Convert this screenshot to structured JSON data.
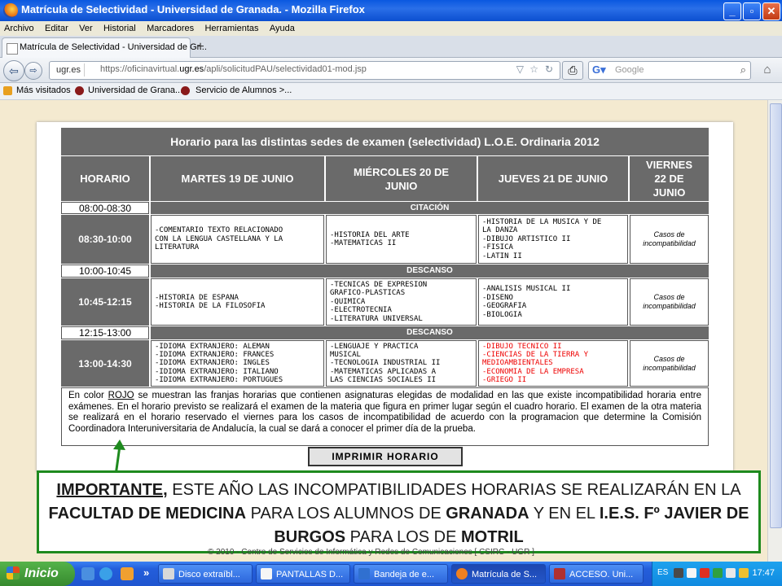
{
  "window": {
    "title": "Matrícula de Selectividad - Universidad de Granada. - Mozilla Firefox"
  },
  "menu": [
    "Archivo",
    "Editar",
    "Ver",
    "Historial",
    "Marcadores",
    "Herramientas",
    "Ayuda"
  ],
  "tab": {
    "label": "Matrícula de Selectividad - Universidad de Gr...",
    "new_tab": "+"
  },
  "nav": {
    "site": "ugr.es",
    "url_pre": "https://oficinavirtual.",
    "url_host": "ugr.es",
    "url_post": "/apli/solicitudPAU/selectividad01-mod.jsp",
    "search_engine": "Google",
    "search_placeholder": "Google"
  },
  "bookmarks": [
    "Más visitados",
    "Universidad de Grana...",
    "Servicio de Alumnos >..."
  ],
  "schedule": {
    "title": "Horario para las distintas sedes de examen (selectividad) L.O.E. Ordinaria 2012",
    "headers": [
      "HORARIO",
      "MARTES 19 DE JUNIO",
      "MIÉRCOLES 20 DE JUNIO",
      "JUEVES 21 DE JUNIO",
      "VIERNES 22 DE JUNIO"
    ],
    "t1": "08:00-08:30",
    "b1": "CITACIÓN",
    "t2": "08:30-10:00",
    "r1_tue": [
      "-COMENTARIO TEXTO RELACIONADO",
      "CON LA LENGUA CASTELLANA Y LA",
      "LITERATURA"
    ],
    "r1_wed": [
      "-HISTORIA DEL ARTE",
      "-MATEMÁTICAS II"
    ],
    "r1_thu": [
      "-HISTORIA DE LA MÚSICA Y DE",
      "LA DANZA",
      "-DIBUJO ARTÍSTICO II",
      "-FÍSICA",
      "-LATÍN II"
    ],
    "casos": "Casos de incompatibilidad",
    "t3": "10:00-10:45",
    "b2": "DESCANSO",
    "t4": "10:45-12:15",
    "r2_tue": [
      "-HISTORIA DE ESPAÑA",
      "-HISTORIA DE LA FILOSOFÍA"
    ],
    "r2_wed": [
      "-TÉCNICAS DE EXPRESIÓN",
      "GRÁFICO-PLÁSTICAS",
      "-QUÍMICA",
      "-ELECTROTECNIA",
      "-LITERATURA UNIVERSAL"
    ],
    "r2_thu": [
      "-ANÁLISIS MUSICAL II",
      "-DISEÑO",
      "-GEOGRAFÍA",
      "-BIOLOGÍA"
    ],
    "t5": "12:15-13:00",
    "b3": "DESCANSO",
    "t6": "13:00-14:30",
    "r3_tue": [
      "-IDIOMA EXTRANJERO: ALEMÁN",
      "-IDIOMA EXTRANJERO: FRANCÉS",
      "-IDIOMA EXTRANJERO: INGLÉS",
      "-IDIOMA EXTRANJERO: ITALIANO",
      "-IDIOMA EXTRANJERO: PORTUGUÉS"
    ],
    "r3_wed": [
      "-LENGUAJE Y PRÁCTICA",
      "MUSICAL",
      "-TECNOLOGÍA INDUSTRIAL II",
      "-MATEMÁTICAS APLICADAS A",
      "LAS CIENCIAS SOCIALES II"
    ],
    "r3_thu": [
      "-DIBUJO TÉCNICO II",
      "-CIENCIAS DE LA TIERRA Y",
      "MEDIOAMBIENTALES",
      "-ECONOMÍA DE LA EMPRESA",
      "-GRIEGO II"
    ],
    "note_a": "En color ",
    "note_rojo": "ROJO",
    "note_b": " se muestran las franjas horarias que contienen asignaturas elegidas de modalidad en las que existe incompatibilidad horaria entre exámenes. En el horario previsto se realizará el examen de la materia que figura en primer lugar según el cuadro horario. El examen de la otra materia se realizará en el horario reservado el viernes para los casos de incompatibilidad de acuerdo con la programacion que determine la Comisión Coordinadora Interuniversitaria de Andalucía, la cual se dará a conocer el primer día de la prueba.",
    "print_button": "IMPRIMIR HORARIO"
  },
  "notice": {
    "p1": "IMPORTANTE,",
    "p2": " ESTE AÑO LAS INCOMPATIBILIDADES HORARIAS SE REALIZARÁN EN LA ",
    "p3": "FACULTAD DE MEDICINA",
    "p4": " PARA LOS ALUMNOS DE ",
    "p5": "GRANADA",
    "p6": " Y EN EL ",
    "p7": "I.E.S. Fº JAVIER DE BURGOS",
    "p8": " PARA LOS DE ",
    "p9": "MOTRIL"
  },
  "footer": "© 2010 - Centro de Servicios de Informática y Redes de Comunicaciones [ CSIRC - UGR ]",
  "taskbar": {
    "start": "Inicio",
    "more": "»",
    "items": [
      "Disco extraíbl...",
      "PANTALLAS D...",
      "Bandeja de e...",
      "Matrícula de S...",
      "ACCESO. Uni...",
      "ES"
    ],
    "clock": "17:47"
  },
  "colors": {
    "accent_green": "#1e8a1e",
    "header_gray": "#6a6a6a",
    "incompat_red": "#e00000",
    "page_bg": "#f4ead0"
  }
}
